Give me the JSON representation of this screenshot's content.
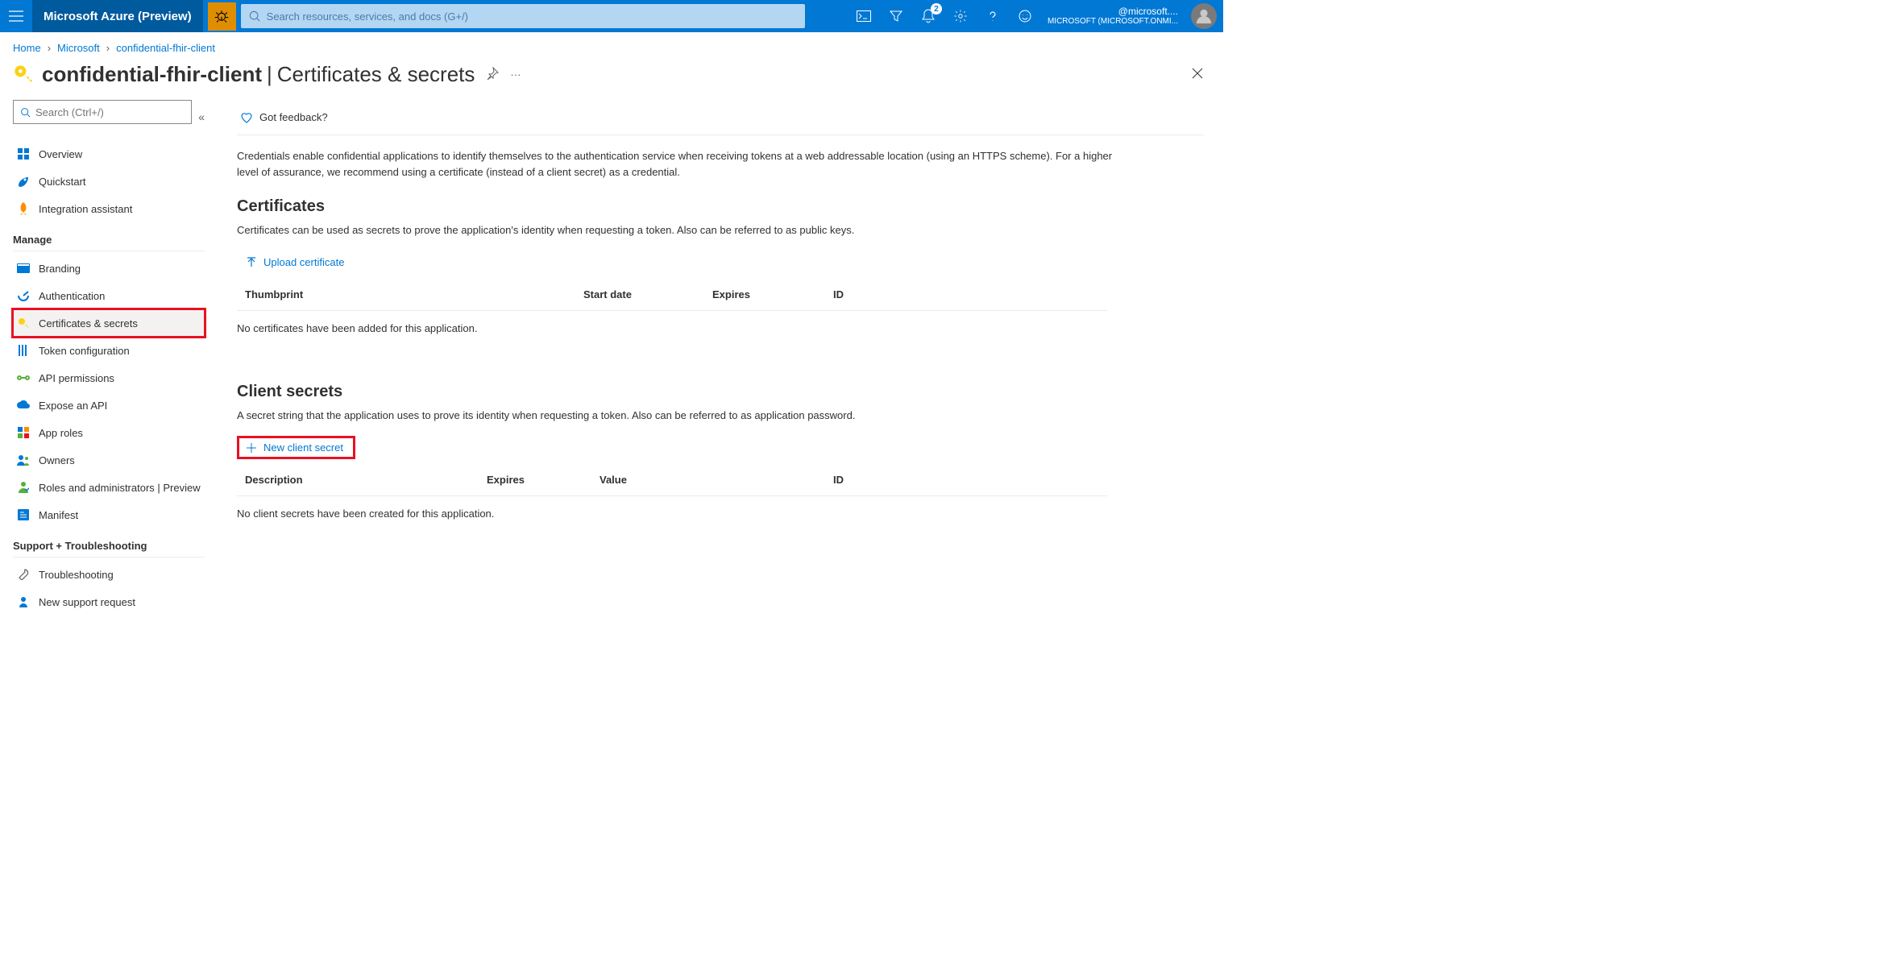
{
  "topbar": {
    "product": "Microsoft Azure (Preview)",
    "search_placeholder": "Search resources, services, and docs (G+/)",
    "bell_badge": "2",
    "account_name": "@microsoft....",
    "directory": "MICROSOFT (MICROSOFT.ONMI..."
  },
  "breadcrumb": {
    "items": [
      "Home",
      "Microsoft",
      "confidential-fhir-client"
    ]
  },
  "page": {
    "resource_name": "confidential-fhir-client",
    "section_title": "Certificates & secrets"
  },
  "sidebar": {
    "search_placeholder": "Search (Ctrl+/)",
    "top": [
      {
        "label": "Overview",
        "color": "#0078d4"
      },
      {
        "label": "Quickstart",
        "color": "#0078d4"
      },
      {
        "label": "Integration assistant",
        "color": "#ff8c00"
      }
    ],
    "manage_header": "Manage",
    "manage": [
      {
        "label": "Branding"
      },
      {
        "label": "Authentication"
      },
      {
        "label": "Certificates & secrets",
        "active": true,
        "highlighted": true
      },
      {
        "label": "Token configuration"
      },
      {
        "label": "API permissions"
      },
      {
        "label": "Expose an API"
      },
      {
        "label": "App roles"
      },
      {
        "label": "Owners"
      },
      {
        "label": "Roles and administrators | Preview"
      },
      {
        "label": "Manifest"
      }
    ],
    "support_header": "Support + Troubleshooting",
    "support": [
      {
        "label": "Troubleshooting"
      },
      {
        "label": "New support request"
      }
    ]
  },
  "main": {
    "feedback": "Got feedback?",
    "intro": "Credentials enable confidential applications to identify themselves to the authentication service when receiving tokens at a web addressable location (using an HTTPS scheme). For a higher level of assurance, we recommend using a certificate (instead of a client secret) as a credential.",
    "certificates": {
      "heading": "Certificates",
      "desc": "Certificates can be used as secrets to prove the application's identity when requesting a token. Also can be referred to as public keys.",
      "upload": "Upload certificate",
      "columns": [
        "Thumbprint",
        "Start date",
        "Expires",
        "ID"
      ],
      "empty": "No certificates have been added for this application."
    },
    "secrets": {
      "heading": "Client secrets",
      "desc": "A secret string that the application uses to prove its identity when requesting a token. Also can be referred to as application password.",
      "new": "New client secret",
      "columns": [
        "Description",
        "Expires",
        "Value",
        "ID"
      ],
      "empty": "No client secrets have been created for this application."
    }
  }
}
